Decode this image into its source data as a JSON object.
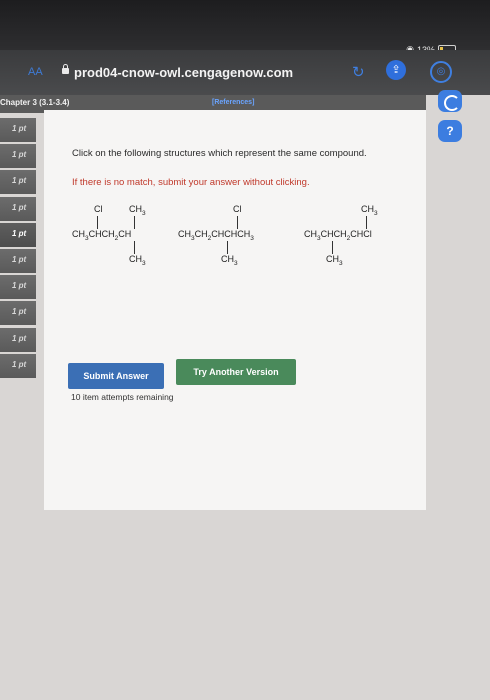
{
  "status": {
    "battery": "13%"
  },
  "browser": {
    "reader": "AA",
    "url": "prod04-cnow-owl.cengagenow.com"
  },
  "header": {
    "chapter": "Chapter 3 (3.1-3.4)",
    "references": "[References]"
  },
  "points": [
    "1 pt",
    "1 pt",
    "1 pt",
    "1 pt",
    "1 pt",
    "1 pt",
    "1 pt",
    "1 pt",
    "1 pt",
    "1 pt"
  ],
  "question": {
    "text": "Click on the following structures which represent the same compound.",
    "hint": "If there is no match, submit your answer without clicking."
  },
  "structures": [
    {
      "top_left": "Cl",
      "top_right": "CH3",
      "main": "CH3CHCH2CH",
      "bottom": "CH3"
    },
    {
      "top": "Cl",
      "main": "CH3CH2CHCHCH3",
      "bottom": "CH3"
    },
    {
      "top": "CH3",
      "main": "CH3CHCH2CHCl",
      "bottom": "CH3"
    }
  ],
  "buttons": {
    "submit": "Submit Answer",
    "try_another": "Try Another Version"
  },
  "attempts": "10 item attempts remaining",
  "colors": {
    "submit": "#3b6fb5",
    "try_another": "#4a8a5b",
    "hint": "#c0392b",
    "accent": "#3c7de0"
  }
}
